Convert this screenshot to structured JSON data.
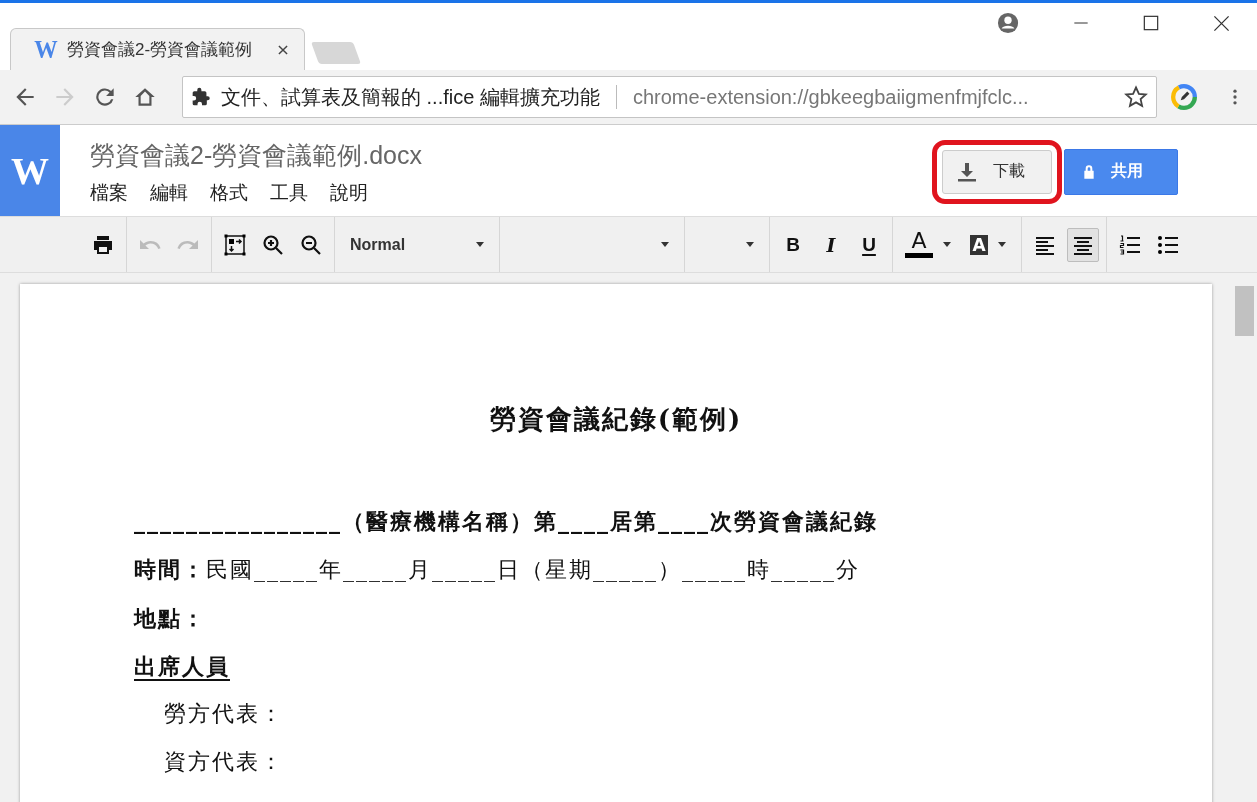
{
  "browser": {
    "tabs": [
      {
        "icon_letter": "W",
        "title": "勞資會議2-勞資會議範例",
        "selected": true
      }
    ],
    "nav": [
      {
        "kind": "back",
        "disabled": false
      },
      {
        "kind": "forward",
        "disabled": true
      },
      {
        "kind": "reload",
        "disabled": false
      },
      {
        "kind": "home",
        "disabled": false
      }
    ],
    "omnibox": {
      "page_title": "文件、試算表及簡報的 ...fice 編輯擴充功能",
      "url": "chrome-extension://gbkeegbaiigmenfmjfclc..."
    }
  },
  "app": {
    "logo": "W",
    "file_name": "勞資會議2-勞資會議範例.docx",
    "menu": [
      "檔案",
      "編輯",
      "格式",
      "工具",
      "說明"
    ],
    "buttons": [
      {
        "kind": "download",
        "label": "下載",
        "highlighted": true
      },
      {
        "kind": "share",
        "label": "共用",
        "highlighted": false
      }
    ]
  },
  "toolbar": {
    "groups": [
      [
        {
          "kind": "print",
          "disabled": false
        }
      ],
      [
        {
          "kind": "undo",
          "disabled": true
        },
        {
          "kind": "redo",
          "disabled": true
        }
      ],
      [
        {
          "kind": "fit",
          "disabled": false
        },
        {
          "kind": "zoom-in",
          "disabled": false
        },
        {
          "kind": "zoom-out",
          "disabled": false
        }
      ],
      [
        {
          "kind": "dropdown",
          "value": "Normal",
          "disabled": false
        }
      ],
      [
        {
          "kind": "dropdown",
          "disabled": false
        }
      ],
      [
        {
          "kind": "dropdown",
          "disabled": false
        }
      ],
      [
        {
          "kind": "bold",
          "label": "B",
          "disabled": false
        },
        {
          "kind": "italic",
          "label": "I",
          "disabled": false
        },
        {
          "kind": "underline",
          "label": "U",
          "disabled": false
        }
      ],
      [
        {
          "kind": "text-color",
          "label": "A",
          "disabled": false
        },
        {
          "kind": "highlight-color",
          "label": "A",
          "disabled": false
        }
      ],
      [
        {
          "kind": "align-left",
          "disabled": false,
          "selected": false
        },
        {
          "kind": "align-center",
          "disabled": false,
          "selected": true
        }
      ],
      [
        {
          "kind": "numbered-list",
          "disabled": false
        },
        {
          "kind": "bulleted-list",
          "disabled": false
        }
      ]
    ]
  },
  "document": {
    "title": "勞資會議紀錄(範例)",
    "lines": [
      {
        "kind": "bold",
        "text": "________________（醫療機構名稱）第____居第____次勞資會議紀錄"
      },
      {
        "kind": "plain",
        "text": "**時間：**民國_____年_____月_____日（星期_____）_____時_____分"
      },
      {
        "kind": "bold",
        "text": "地點："
      },
      {
        "kind": "underlined",
        "text": "出席人員"
      },
      {
        "kind": "indented",
        "text": "勞方代表："
      },
      {
        "kind": "indented",
        "text": "資方代表："
      }
    ]
  }
}
